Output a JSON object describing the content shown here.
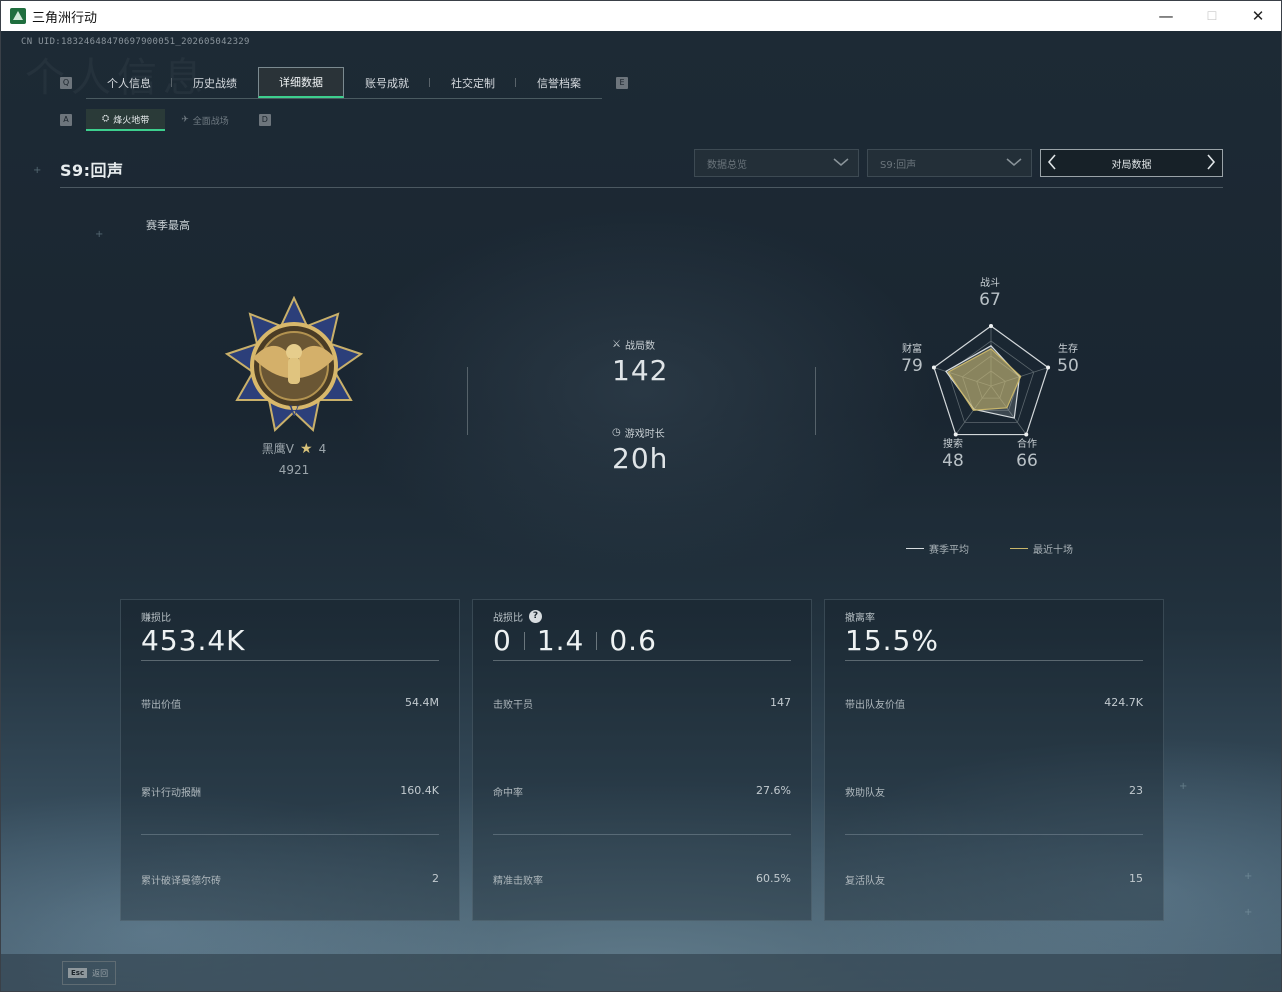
{
  "window": {
    "title": "三角洲行动",
    "controls": {
      "minimize": "—",
      "maximize": "☐",
      "close": "✕"
    }
  },
  "header": {
    "uid": "CN UID:18324648470697900051_202605042329",
    "watermark": "个人信息"
  },
  "nav": {
    "left_key": "Q",
    "right_key": "E",
    "tabs": [
      {
        "label": "个人信息",
        "active": false
      },
      {
        "label": "历史战绩",
        "active": false
      },
      {
        "label": "详细数据",
        "active": true
      },
      {
        "label": "账号成就",
        "active": false
      },
      {
        "label": "社交定制",
        "active": false
      },
      {
        "label": "信誉档案",
        "active": false
      }
    ]
  },
  "subnav": {
    "left_key": "A",
    "right_key": "D",
    "tabs": [
      {
        "label": "烽火地带",
        "icon": "flame-zone-icon",
        "active": true
      },
      {
        "label": "全面战场",
        "icon": "battlefield-icon",
        "active": false
      }
    ]
  },
  "season_title": "S9:回声",
  "filters": {
    "data_scope": "数据总览",
    "season": "S9:回声",
    "switcher_label": "对局数据"
  },
  "season_best": {
    "label": "赛季最高",
    "rank_name": "黑鹰V",
    "stars": "4",
    "score": "4921"
  },
  "summary": {
    "matches_label": "战局数",
    "matches_value": "142",
    "playtime_label": "游戏时长",
    "playtime_value": "20h"
  },
  "radar": {
    "axes": [
      {
        "label": "战斗",
        "value": "67"
      },
      {
        "label": "生存",
        "value": "50"
      },
      {
        "label": "合作",
        "value": "66"
      },
      {
        "label": "搜索",
        "value": "48"
      },
      {
        "label": "财富",
        "value": "79"
      }
    ],
    "season_avg": [
      0.67,
      0.5,
      0.66,
      0.48,
      0.79
    ],
    "recent_ten": [
      0.62,
      0.52,
      0.45,
      0.5,
      0.75
    ],
    "legend": {
      "season_avg": "赛季平均",
      "recent_ten": "最近十场"
    },
    "colors": {
      "season_avg": "#d7dcdf",
      "recent_ten": "#c9b66a"
    }
  },
  "panels": [
    {
      "title": "赚损比",
      "big": "453.4K",
      "rows": [
        {
          "label": "带出价值",
          "value": "54.4M"
        },
        {
          "label": "累计行动报酬",
          "value": "160.4K"
        },
        {
          "label": "累计破译曼德尔砖",
          "value": "2"
        }
      ]
    },
    {
      "title": "战损比",
      "big_parts": [
        "0",
        "1.4",
        "0.6"
      ],
      "help": "?",
      "rows": [
        {
          "label": "击败干员",
          "value": "147"
        },
        {
          "label": "命中率",
          "value": "27.6%"
        },
        {
          "label": "精准击败率",
          "value": "60.5%"
        }
      ]
    },
    {
      "title": "撤离率",
      "big": "15.5%",
      "rows": [
        {
          "label": "带出队友价值",
          "value": "424.7K"
        },
        {
          "label": "救助队友",
          "value": "23"
        },
        {
          "label": "复活队友",
          "value": "15"
        }
      ]
    }
  ],
  "footer": {
    "esc_key": "Esc",
    "esc_label": "返回"
  }
}
